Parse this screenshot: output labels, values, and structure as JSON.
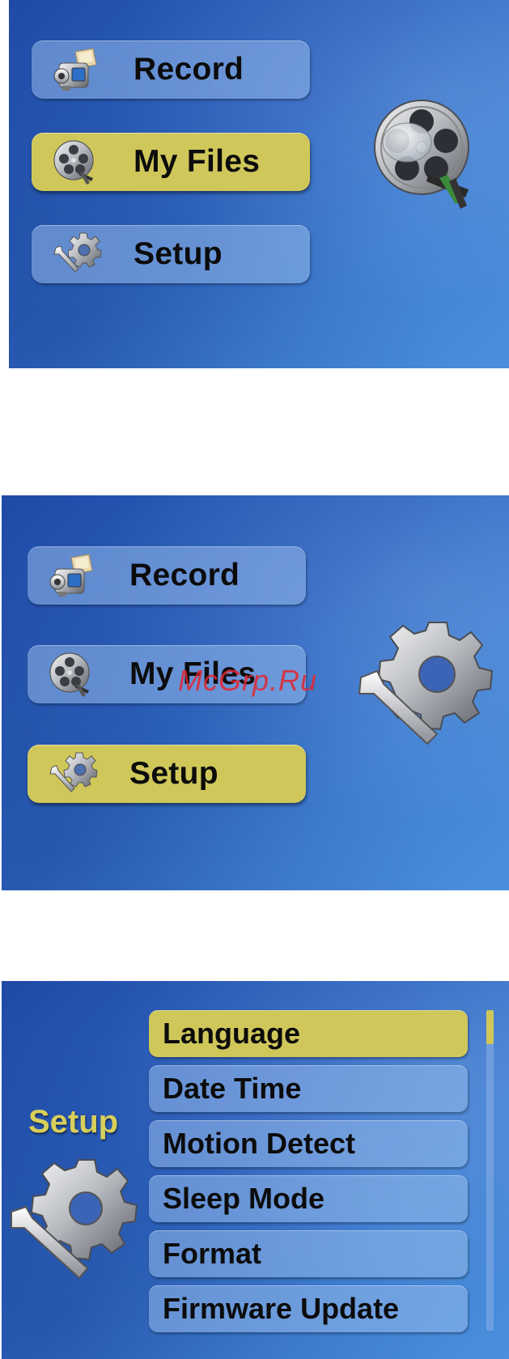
{
  "screen1": {
    "menu": [
      {
        "label": "Record",
        "icon": "camcorder-icon",
        "selected": false
      },
      {
        "label": "My Files",
        "icon": "film-reel-icon",
        "selected": true
      },
      {
        "label": "Setup",
        "icon": "gear-wrench-icon",
        "selected": false
      }
    ],
    "preview_icon": "film-reel-icon"
  },
  "screen2": {
    "menu": [
      {
        "label": "Record",
        "icon": "camcorder-icon",
        "selected": false
      },
      {
        "label": "My Files",
        "icon": "film-reel-icon",
        "selected": false
      },
      {
        "label": "Setup",
        "icon": "gear-wrench-icon",
        "selected": true
      }
    ],
    "preview_icon": "gear-wrench-icon"
  },
  "screen3": {
    "title": "Setup",
    "items": [
      {
        "label": "Language",
        "selected": true
      },
      {
        "label": "Date Time",
        "selected": false
      },
      {
        "label": "Motion Detect",
        "selected": false
      },
      {
        "label": "Sleep Mode",
        "selected": false
      },
      {
        "label": "Format",
        "selected": false
      },
      {
        "label": "Firmware Update",
        "selected": false
      }
    ]
  },
  "watermark": "McGrp.Ru",
  "colors": {
    "background_blue": "#2f66c2",
    "selected_yellow": "#cfc75a",
    "button_blue": "#96b9eb",
    "title_yellow": "#d8cf5c",
    "watermark_red": "#e5252d"
  }
}
